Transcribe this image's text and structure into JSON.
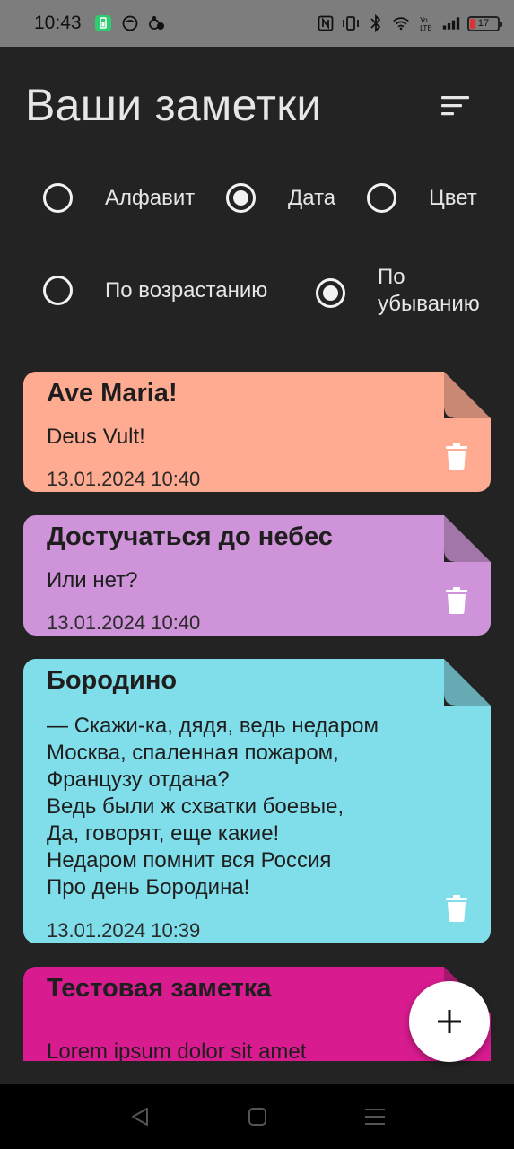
{
  "status_bar": {
    "time": "10:43",
    "battery_level": "17",
    "left_icons": [
      "battery-saver-icon",
      "face-icon",
      "bubbles-icon"
    ],
    "right_icons": [
      "nfc-icon",
      "vibrate-icon",
      "bluetooth-icon",
      "wifi-icon",
      "volte-icon",
      "signal-icon"
    ]
  },
  "header": {
    "title": "Ваши заметки",
    "sort_icon": "sort-icon"
  },
  "sort_field": {
    "options": [
      {
        "label": "Алфавит",
        "checked": false
      },
      {
        "label": "Дата",
        "checked": true
      },
      {
        "label": "Цвет",
        "checked": false
      }
    ]
  },
  "sort_order": {
    "options": [
      {
        "label": "По возрастанию",
        "checked": false
      },
      {
        "label": "По\nубыванию",
        "checked": true
      }
    ]
  },
  "notes": [
    {
      "title": "Ave Maria!",
      "text": "Deus Vult!",
      "date": "13.01.2024 10:40",
      "color": "#ffab91",
      "fold_color": "#c98874"
    },
    {
      "title": "Достучаться до небес",
      "text": "Или нет?",
      "date": "13.01.2024 10:40",
      "color": "#ce93d8",
      "fold_color": "#a376aa"
    },
    {
      "title": "Бородино",
      "text": "— Скажи-ка, дядя, ведь недаром\nМосква, спаленная пожаром,\nФранцузу отдана?\nВедь были ж схватки боевые,\nДа, говорят, еще какие!\nНедаром помнит вся Россия\nПро день Бородина!",
      "date": "13.01.2024 10:39",
      "color": "#80deea",
      "fold_color": "#66aab3"
    },
    {
      "title": "Тестовая заметка",
      "text": "Lorem ipsum dolor sit amet",
      "date": "",
      "color": "#d81b8f",
      "fold_color": "#a6186f"
    }
  ],
  "fab": {
    "icon": "plus-icon"
  },
  "nav_bar": {
    "icons": [
      "back-icon",
      "home-icon",
      "menu-icon"
    ]
  }
}
